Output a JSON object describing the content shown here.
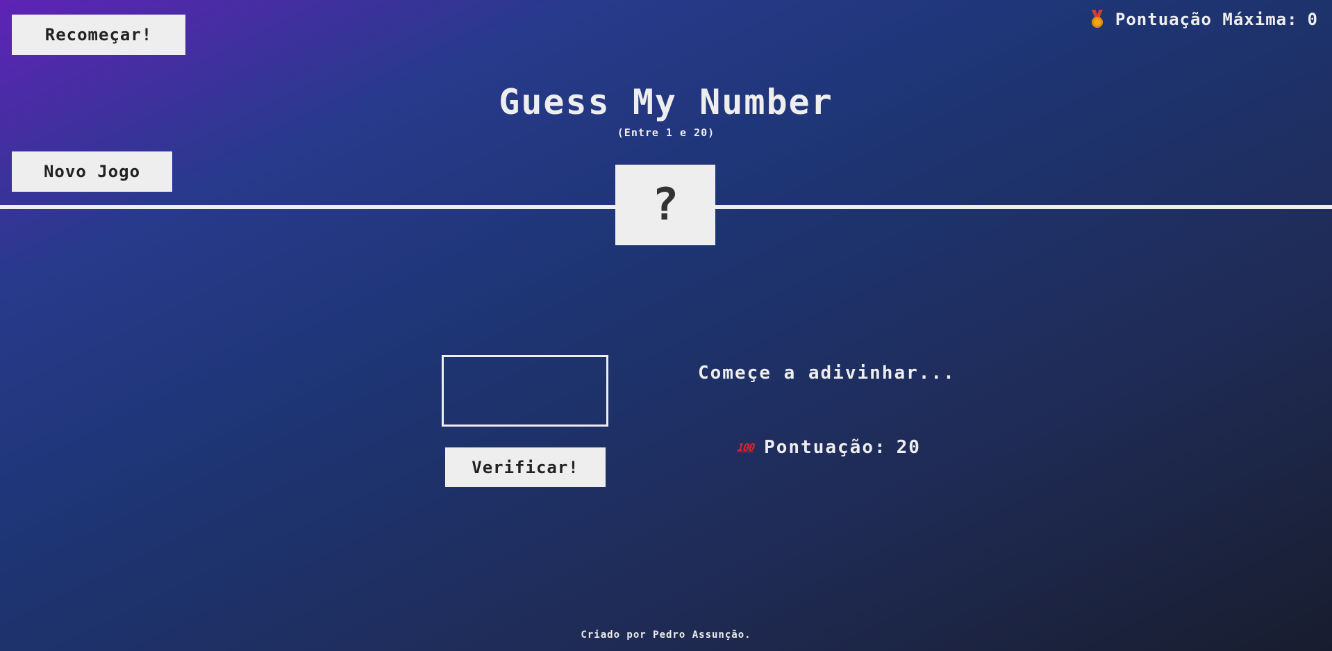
{
  "header": {
    "restart_label": "Recomeçar!",
    "new_game_label": "Novo Jogo",
    "highscore_icon": "medal-icon",
    "highscore_label": "Pontuação Máxima:",
    "highscore_value": "0"
  },
  "game": {
    "title": "Guess My Number",
    "subtitle": "(Entre 1 e 20)",
    "secret_number": "?",
    "guess_value": "",
    "check_label": "Verificar!",
    "message": "Começe a adivinhar...",
    "score_icon": "hundred-points-icon",
    "score_label": "Pontuação:",
    "score_value": "20"
  },
  "footer": {
    "credit": "Criado por Pedro Assunção."
  },
  "colors": {
    "background_start": "#5f23b6",
    "background_mid": "#1e3575",
    "background_end": "#181d2e",
    "panel": "#eeeeee",
    "text_dark": "#222222"
  }
}
